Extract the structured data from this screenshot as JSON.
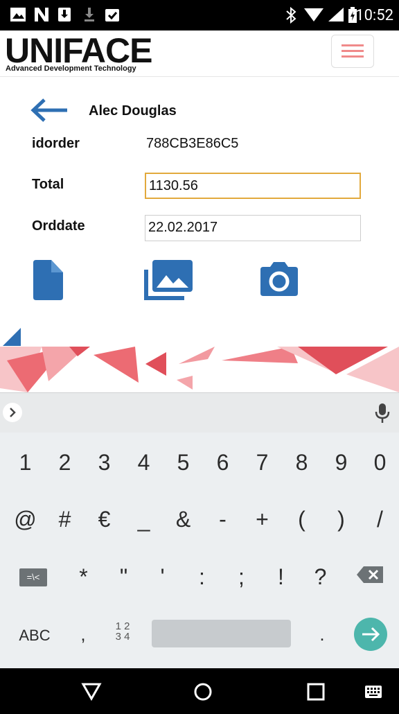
{
  "status_bar": {
    "time": "10:52"
  },
  "header": {
    "logo_text": "UNIFACE",
    "logo_subtitle": "Advanced Development Technology"
  },
  "record": {
    "name": "Alec Douglas",
    "fields": {
      "idorder": {
        "label": "idorder",
        "value": "788CB3E86C5"
      },
      "total": {
        "label": "Total",
        "value": "1130.56"
      },
      "orddate": {
        "label": "Orddate",
        "value": "22.02.2017"
      }
    }
  },
  "keyboard": {
    "row1": [
      "1",
      "2",
      "3",
      "4",
      "5",
      "6",
      "7",
      "8",
      "9",
      "0"
    ],
    "row2": [
      "@",
      "#",
      "€",
      "_",
      "&",
      "-",
      "+",
      "(",
      ")",
      "/"
    ],
    "row3": [
      "=\\<",
      "*",
      "\"",
      "'",
      ":",
      ";",
      "!",
      "?"
    ],
    "row4": {
      "abc": "ABC",
      "comma": ",",
      "numpad": "1 2\n3 4",
      "period": "."
    }
  },
  "colors": {
    "accent": "#2e6fb3",
    "focus_border": "#e2a93c",
    "enter_key": "#4db6ac",
    "menu_lines": "#f08a8a"
  }
}
